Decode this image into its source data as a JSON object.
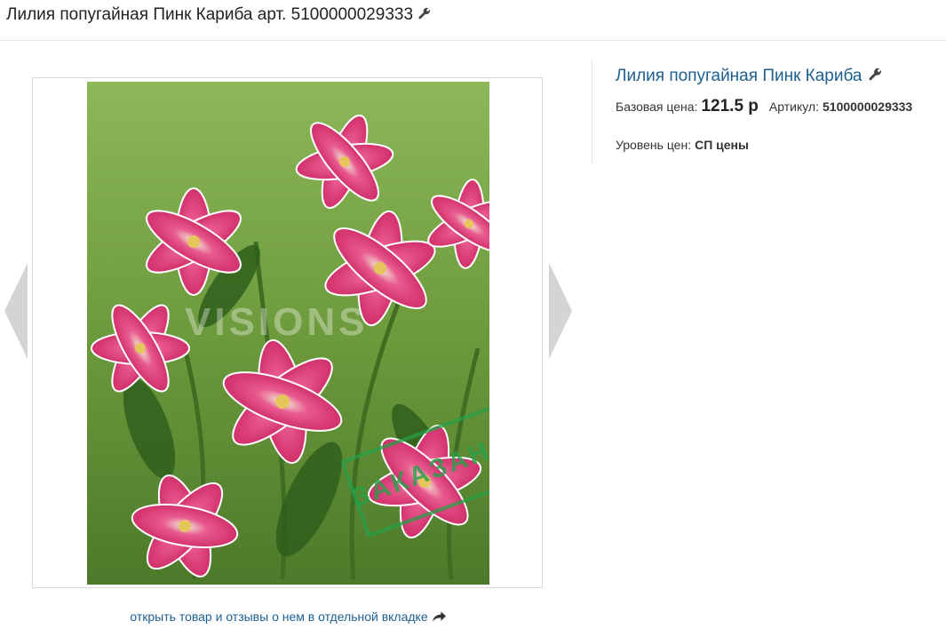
{
  "header": {
    "title": "Лилия попугайная Пинк Кариба арт. 5100000029333",
    "edit_icon": "wrench-icon"
  },
  "gallery": {
    "prev_icon": "chevron-left-icon",
    "next_icon": "chevron-right-icon",
    "image_subject": "pink lily flowers photo",
    "stamp_text": "ЗАКАЗАНО",
    "watermark_text": "VISIONS"
  },
  "open_link": {
    "label": "открыть товар и отзывы о нем в отдельной вкладке",
    "icon": "share-arrow-icon"
  },
  "product": {
    "name": "Лилия попугайная Пинк Кариба",
    "edit_icon": "wrench-icon",
    "base_price_label": "Базовая цена:",
    "base_price_value": "121.5 р",
    "sku_label": "Артикул:",
    "sku_value": "5100000029333",
    "price_level_label": "Уровень цен:",
    "price_level_value": "СП цены"
  },
  "colors": {
    "link": "#1c5f91",
    "stamp": "#26a048",
    "arrow": "#d0d0d0"
  }
}
